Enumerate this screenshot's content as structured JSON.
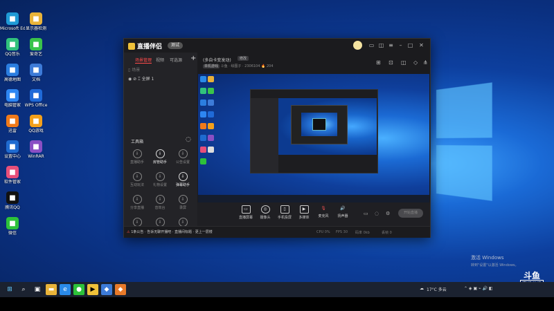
{
  "desktop": {
    "icons": [
      {
        "label": "Microsoft Edge",
        "icon": "edge-icon",
        "color": "#1f9ad6"
      },
      {
        "label": "显示器检测",
        "icon": "folder-icon",
        "color": "#e9b43a"
      },
      {
        "label": "QQ音乐",
        "icon": "qqmusic-icon",
        "color": "#31c27c"
      },
      {
        "label": "爱奇艺",
        "icon": "video-icon",
        "color": "#3ac34a"
      },
      {
        "label": "高德地图",
        "icon": "map-icon",
        "color": "#2b7ee0"
      },
      {
        "label": "文档",
        "icon": "doc-icon",
        "color": "#3d7bd8"
      },
      {
        "label": "电脑管家",
        "icon": "shield-icon",
        "color": "#2d86f2"
      },
      {
        "label": "WPS Office",
        "icon": "wps-icon",
        "color": "#1f6ad8"
      },
      {
        "label": "迅雷",
        "icon": "game-icon",
        "color": "#f07a1a"
      },
      {
        "label": "QQ游戏",
        "icon": "qqgame-icon",
        "color": "#f3a01b"
      },
      {
        "label": "设置中心",
        "icon": "settings-icon",
        "color": "#1f6bd0"
      },
      {
        "label": "WinRAR",
        "icon": "archive-icon",
        "color": "#8a4fc4"
      },
      {
        "label": "软件管家",
        "icon": "apps-icon",
        "color": "#e74f7a"
      },
      {
        "label": "腾讯QQ",
        "icon": "qq-icon",
        "color": "#111111"
      },
      {
        "label": "微信",
        "icon": "wechat-icon",
        "color": "#2dc23a"
      }
    ]
  },
  "app": {
    "name": "直播伴侣",
    "version_badge": "测试",
    "left_tabs": [
      "场景管理",
      "视频",
      "可选源"
    ],
    "scene_header": "场景",
    "scene_item": "全屏 1",
    "toolbox_title": "工具箱",
    "tools": [
      {
        "label": "直播助手",
        "hl": false
      },
      {
        "label": "房管助手",
        "hl": true
      },
      {
        "label": "公告设置",
        "hl": false
      },
      {
        "label": "互动玩法",
        "hl": false
      },
      {
        "label": "礼物设置",
        "hl": false
      },
      {
        "label": "弹幕助手",
        "hl": true
      },
      {
        "label": "分享直播",
        "hl": false
      },
      {
        "label": "音效台",
        "hl": false
      },
      {
        "label": "录屏",
        "hl": false
      },
      {
        "label": "直播数据",
        "hl": false
      },
      {
        "label": "粉丝团",
        "hl": false
      },
      {
        "label": "更多",
        "hl": false
      }
    ],
    "room": {
      "title": "(多自卡变发动)",
      "tag": "修改",
      "category_chip": "单机游戏",
      "meta": "斗鱼 · 绘图子 · 2306104",
      "online": "204"
    },
    "controls": [
      {
        "label": "直播屏幕"
      },
      {
        "label": "摄像头"
      },
      {
        "label": "手机投屏"
      },
      {
        "label": "多媒体"
      },
      {
        "label": "麦克风"
      },
      {
        "label": "扬声器"
      }
    ],
    "start_label": "开始直播",
    "status": {
      "warning_prefix": "1",
      "warning": "条公告 · 告诉无聊开播吧 · 直播间标题 · 更上一层楼",
      "cpu": "CPU 0%",
      "fps": "FPS 30",
      "bitrate": "码率 0kb",
      "drop": "丢帧 0"
    }
  },
  "activation": {
    "line1": "激活 Windows",
    "line2": "转到\"设置\"以激活 Windows。"
  },
  "watermark": {
    "brand": "斗鱼",
    "sub": "直播伴侣",
    "room_id": "2306104"
  },
  "taskbar": {
    "weather": "17°C 多云",
    "colors": {
      "bar": "#1b2230"
    }
  }
}
